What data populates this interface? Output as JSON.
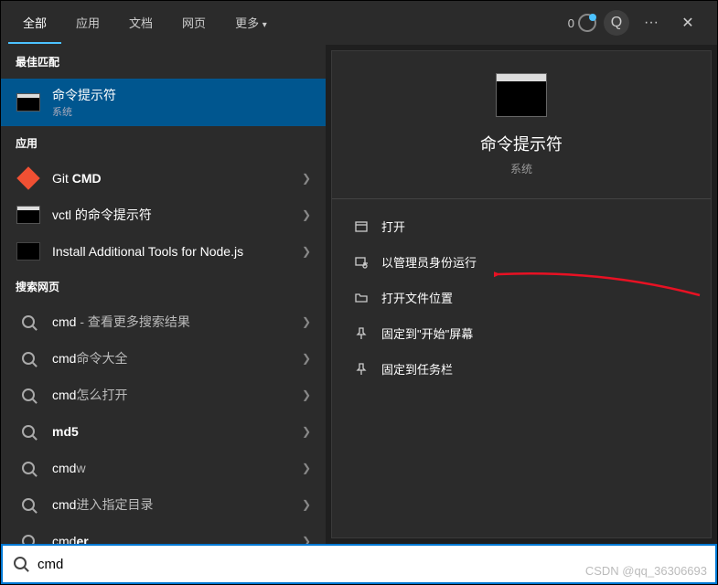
{
  "topbar": {
    "tabs": [
      "全部",
      "应用",
      "文档",
      "网页",
      "更多"
    ],
    "active_tab": 0,
    "badge_count": "0",
    "feedback_label": "Q",
    "more_label": "···",
    "close_label": "✕"
  },
  "sections": {
    "best_match": "最佳匹配",
    "apps": "应用",
    "web": "搜索网页"
  },
  "best_match": {
    "title": "命令提示符",
    "sub": "系统"
  },
  "app_results": [
    {
      "title_prefix": "Git ",
      "title_bold": "CMD",
      "icon": "git"
    },
    {
      "title": "vctl 的命令提示符",
      "icon": "cmd"
    },
    {
      "title": "Install Additional Tools for Node.js",
      "icon": "nodejs"
    }
  ],
  "web_results": [
    {
      "prefix": "cmd",
      "suffix": " - 查看更多搜索结果"
    },
    {
      "prefix": "cmd",
      "suffix": "命令大全"
    },
    {
      "prefix": "cmd",
      "suffix": "怎么打开"
    },
    {
      "prefix": "",
      "suffix": "",
      "bold": "md5"
    },
    {
      "prefix": "cmd",
      "suffix": "w"
    },
    {
      "prefix": "cmd",
      "suffix": "进入指定目录"
    },
    {
      "prefix": "cmd",
      "suffix": "",
      "bold_suffix": "er"
    }
  ],
  "preview": {
    "title": "命令提示符",
    "sub": "系统",
    "actions": [
      {
        "icon": "open",
        "label": "打开"
      },
      {
        "icon": "admin",
        "label": "以管理员身份运行"
      },
      {
        "icon": "folder",
        "label": "打开文件位置"
      },
      {
        "icon": "pin",
        "label": "固定到\"开始\"屏幕"
      },
      {
        "icon": "pin",
        "label": "固定到任务栏"
      }
    ]
  },
  "search": {
    "value": "cmd",
    "placeholder": ""
  },
  "watermark": "CSDN @qq_36306693"
}
